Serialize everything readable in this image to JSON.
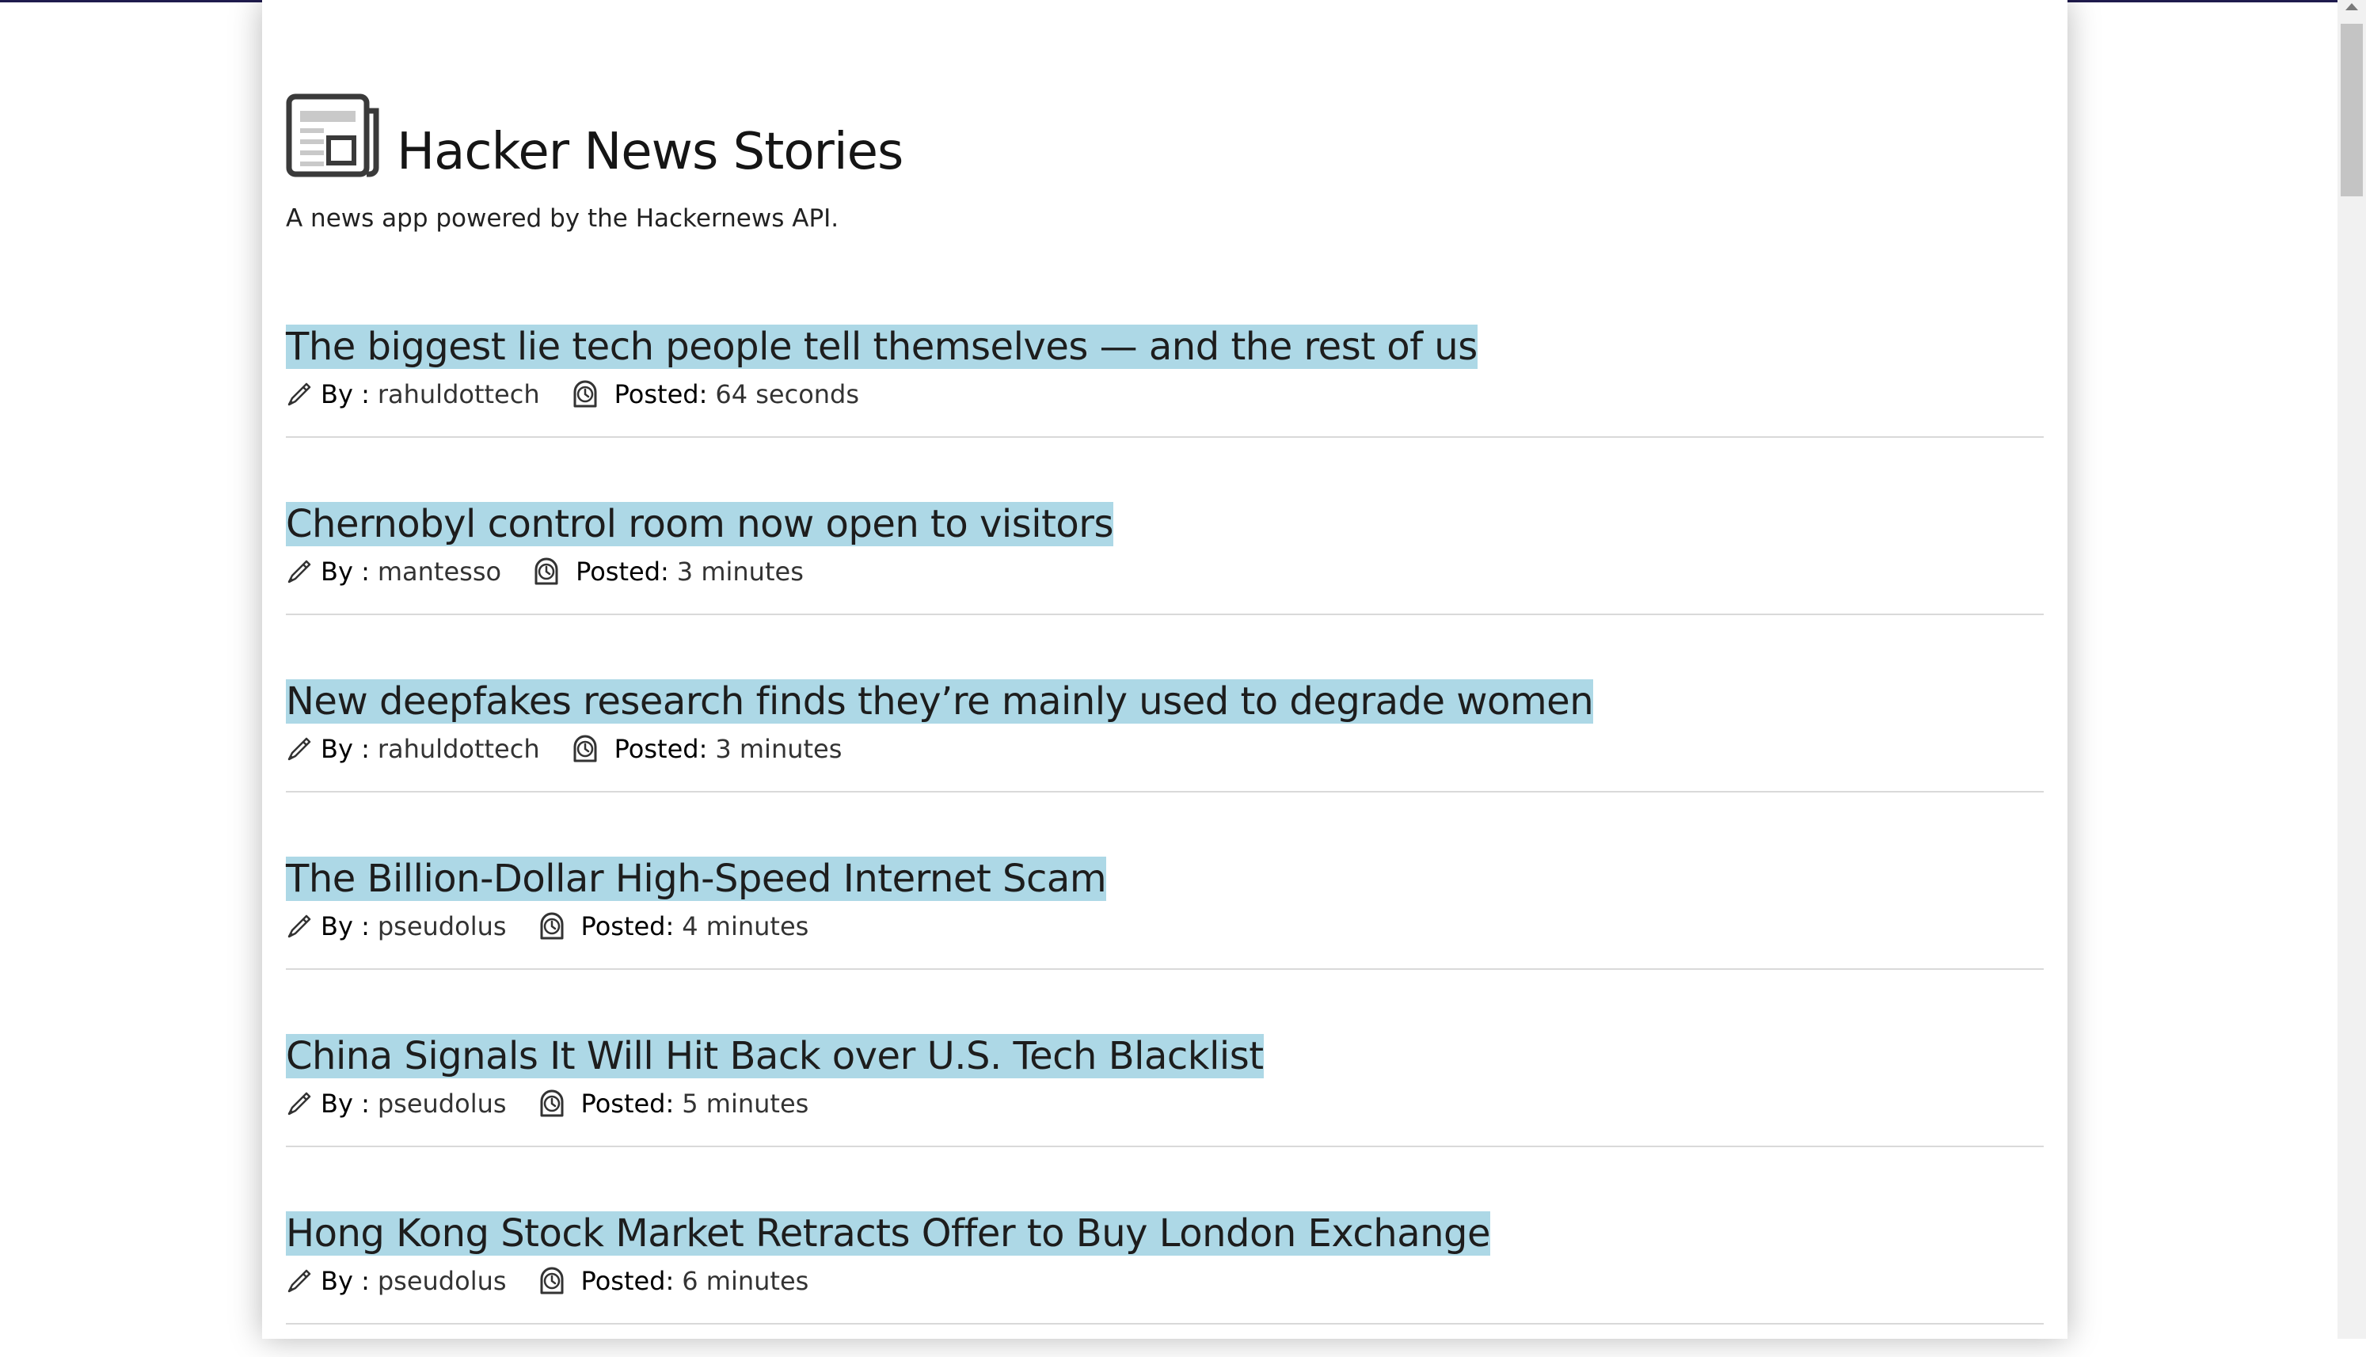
{
  "header": {
    "title": "Hacker News Stories",
    "subtitle": "A news app powered by the Hackernews API.",
    "logo_icon": "newspaper-icon"
  },
  "labels": {
    "by": "By :",
    "posted": "Posted:"
  },
  "icons": {
    "author": "pen-icon",
    "time": "clock-icon"
  },
  "colors": {
    "title_highlight": "#add8e6",
    "top_border": "#1f1b4d",
    "divider": "#d9d9d9"
  },
  "stories": [
    {
      "title": "The biggest lie tech people tell themselves — and the rest of us",
      "author": "rahuldottech",
      "posted": "64 seconds"
    },
    {
      "title": "Chernobyl control room now open to visitors",
      "author": "mantesso",
      "posted": "3 minutes"
    },
    {
      "title": "New deepfakes research finds they’re mainly used to degrade women",
      "author": "rahuldottech",
      "posted": "3 minutes"
    },
    {
      "title": "The Billion-Dollar High-Speed Internet Scam",
      "author": "pseudolus",
      "posted": "4 minutes"
    },
    {
      "title": "China Signals It Will Hit Back over U.S. Tech Blacklist",
      "author": "pseudolus",
      "posted": "5 minutes"
    },
    {
      "title": "Hong Kong Stock Market Retracts Offer to Buy London Exchange",
      "author": "pseudolus",
      "posted": "6 minutes"
    }
  ]
}
